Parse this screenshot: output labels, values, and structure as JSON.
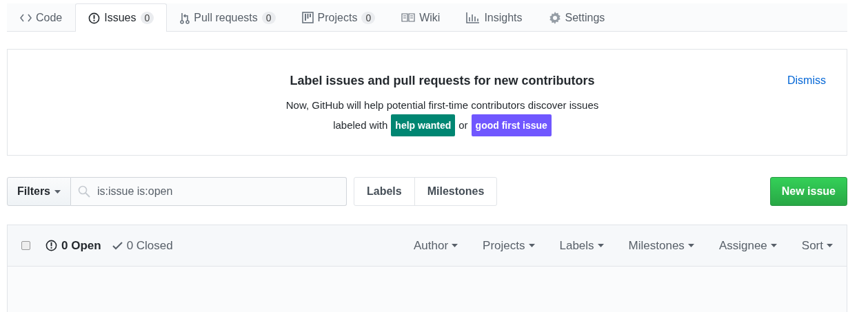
{
  "tabs": [
    {
      "label": "Code",
      "selected": false
    },
    {
      "label": "Issues",
      "counter": "0",
      "selected": true
    },
    {
      "label": "Pull requests",
      "counter": "0",
      "selected": false
    },
    {
      "label": "Projects",
      "counter": "0",
      "selected": false
    },
    {
      "label": "Wiki",
      "selected": false
    },
    {
      "label": "Insights",
      "selected": false
    },
    {
      "label": "Settings",
      "selected": false
    }
  ],
  "banner": {
    "title": "Label issues and pull requests for new contributors",
    "line_1": "Now, GitHub will help potential first-time contributors discover issues",
    "line_2_prefix": "labeled with",
    "labels": [
      {
        "text": "help wanted",
        "color": "#008672"
      },
      {
        "text": "good first issue",
        "color": "#7057ff"
      }
    ],
    "joiner": "or",
    "dismiss": "Dismiss"
  },
  "toolbar": {
    "filters": "Filters",
    "search_value": "is:issue is:open",
    "nav": [
      "Labels",
      "Milestones"
    ],
    "new_issue": "New issue"
  },
  "issues_header": {
    "select_all_checked": false,
    "open": "0 Open",
    "closed": "0 Closed",
    "filters": [
      "Author",
      "Projects",
      "Labels",
      "Milestones",
      "Assignee",
      "Sort"
    ]
  }
}
